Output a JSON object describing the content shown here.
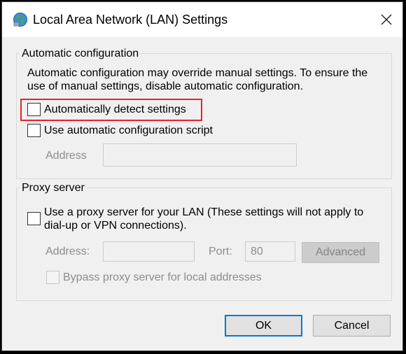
{
  "window": {
    "title": "Local Area Network (LAN) Settings",
    "icon": "network-globe-icon",
    "close_icon": "close-icon"
  },
  "auto_config": {
    "legend": "Automatic configuration",
    "description_line1": "Automatic configuration may override manual settings.  To ensure the",
    "description_line2": "use of manual settings, disable automatic configuration.",
    "detect_label": "Automatically detect settings",
    "detect_checked": false,
    "script_label": "Use automatic configuration script",
    "script_checked": false,
    "address_label": "Address",
    "address_value": ""
  },
  "proxy": {
    "legend": "Proxy server",
    "use_proxy_line1": "Use a proxy server for your LAN (These settings will not apply to",
    "use_proxy_line2": "dial-up or VPN connections).",
    "use_proxy_checked": false,
    "address_label": "Address:",
    "address_value": "",
    "port_label": "Port:",
    "port_value": "80",
    "advanced_label": "Advanced",
    "bypass_label": "Bypass proxy server for local addresses",
    "bypass_checked": false
  },
  "buttons": {
    "ok_label": "OK",
    "cancel_label": "Cancel"
  },
  "colors": {
    "highlight": "#e2242d",
    "default_button_border": "#0078d7",
    "dialog_background": "#f0f0f0"
  }
}
